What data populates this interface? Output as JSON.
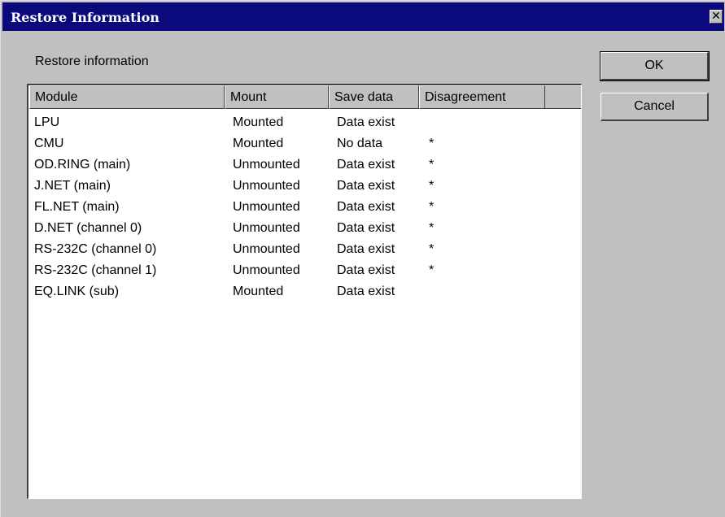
{
  "window": {
    "title": "Restore Information",
    "close_glyph": "✕"
  },
  "label": "Restore information",
  "columns": [
    "Module",
    "Mount",
    "Save data",
    "Disagreement"
  ],
  "rows": [
    {
      "module": "LPU",
      "mount": "Mounted",
      "save": "Data exist",
      "disagreement": ""
    },
    {
      "module": "CMU",
      "mount": "Mounted",
      "save": "No data",
      "disagreement": "*"
    },
    {
      "module": "OD.RING (main)",
      "mount": "Unmounted",
      "save": "Data exist",
      "disagreement": "*"
    },
    {
      "module": "J.NET (main)",
      "mount": "Unmounted",
      "save": "Data exist",
      "disagreement": "*"
    },
    {
      "module": "FL.NET (main)",
      "mount": "Unmounted",
      "save": "Data exist",
      "disagreement": "*"
    },
    {
      "module": "D.NET (channel 0)",
      "mount": "Unmounted",
      "save": "Data exist",
      "disagreement": "*"
    },
    {
      "module": "RS-232C (channel 0)",
      "mount": "Unmounted",
      "save": "Data exist",
      "disagreement": "*"
    },
    {
      "module": "RS-232C (channel 1)",
      "mount": "Unmounted",
      "save": "Data exist",
      "disagreement": "*"
    },
    {
      "module": "EQ.LINK (sub)",
      "mount": "Mounted",
      "save": "Data exist",
      "disagreement": ""
    }
  ],
  "buttons": {
    "ok": "OK",
    "cancel": "Cancel"
  },
  "colors": {
    "titlebar": "#0a0a7c",
    "face": "#c0c0c0",
    "list_bg": "#ffffff"
  }
}
